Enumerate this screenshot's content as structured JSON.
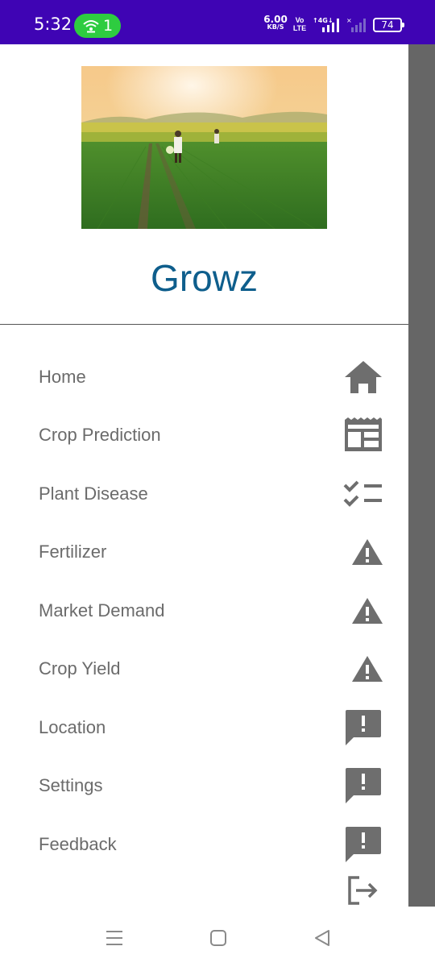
{
  "status_bar": {
    "time": "5:32",
    "hotspot_count": "1",
    "net_speed_value": "6.00",
    "net_speed_unit": "KB/S",
    "volte_top": "Vo",
    "volte_bottom": "LTE",
    "battery": "74",
    "background": "#3f04b4"
  },
  "drawer": {
    "app_title": "Growz",
    "title_color": "#0e5e8c",
    "header_image": "farmer-in-green-field",
    "menu": [
      {
        "label": "Home",
        "icon": "home-icon"
      },
      {
        "label": "Crop Prediction",
        "icon": "newspaper-icon"
      },
      {
        "label": "Plant Disease",
        "icon": "checklist-icon"
      },
      {
        "label": "Fertilizer",
        "icon": "warning-icon"
      },
      {
        "label": "Market Demand",
        "icon": "warning-icon"
      },
      {
        "label": "Crop Yield",
        "icon": "warning-icon"
      },
      {
        "label": "Location",
        "icon": "feedback-icon"
      },
      {
        "label": "Settings",
        "icon": "feedback-icon"
      },
      {
        "label": "Feedback",
        "icon": "feedback-icon"
      }
    ],
    "logout_icon": "logout-icon"
  },
  "nav_bar": {
    "recents": "recents-icon",
    "home": "home-button-icon",
    "back": "back-icon"
  }
}
